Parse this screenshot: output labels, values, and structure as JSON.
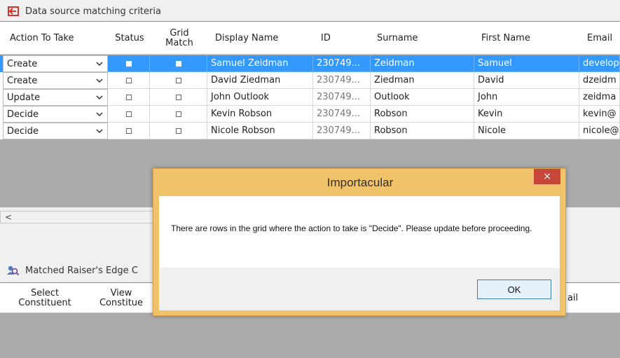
{
  "top_section": {
    "title": "Data source matching criteria",
    "icon": "import-arrow-icon",
    "icon_color": "#d9342b"
  },
  "grid": {
    "columns": [
      "Action To Take",
      "Status",
      "Grid\nMatch",
      "Display Name",
      "ID",
      "Surname",
      "First Name",
      "Email"
    ],
    "rows": [
      {
        "action": "Create",
        "display_name": "Samuel Zeidman",
        "id": "230749...",
        "surname": "Zeidman",
        "first_name": "Samuel",
        "email": "develop",
        "selected": true
      },
      {
        "action": "Create",
        "display_name": "David Ziedman",
        "id": "230749...",
        "surname": "Ziedman",
        "first_name": "David",
        "email": "dzeidm",
        "selected": false
      },
      {
        "action": "Update",
        "display_name": "John Outlook",
        "id": "230749...",
        "surname": "Outlook",
        "first_name": "John",
        "email": "zeidma",
        "selected": false
      },
      {
        "action": "Decide",
        "display_name": "Kevin Robson",
        "id": "230749...",
        "surname": "Robson",
        "first_name": "Kevin",
        "email": "kevin@",
        "selected": false
      },
      {
        "action": "Decide",
        "display_name": "Nicole Robson",
        "id": "230749...",
        "surname": "Robson",
        "first_name": "Nicole",
        "email": "nicole@",
        "selected": false
      }
    ],
    "selected_color": "#3399ff",
    "scroll_left_glyph": "<"
  },
  "bottom_section": {
    "title": "Matched Raiser's Edge C",
    "icon": "people-search-icon",
    "columns": [
      "Select\nConstituent",
      "View\nConstitue",
      "ail"
    ]
  },
  "dialog": {
    "title": "Importacular",
    "message": "There are rows in the grid where the action to take is \"Decide\". Please update before proceeding.",
    "ok_label": "OK",
    "close_glyph": "×",
    "frame_color": "#f0c26a",
    "close_color": "#c7463a"
  }
}
